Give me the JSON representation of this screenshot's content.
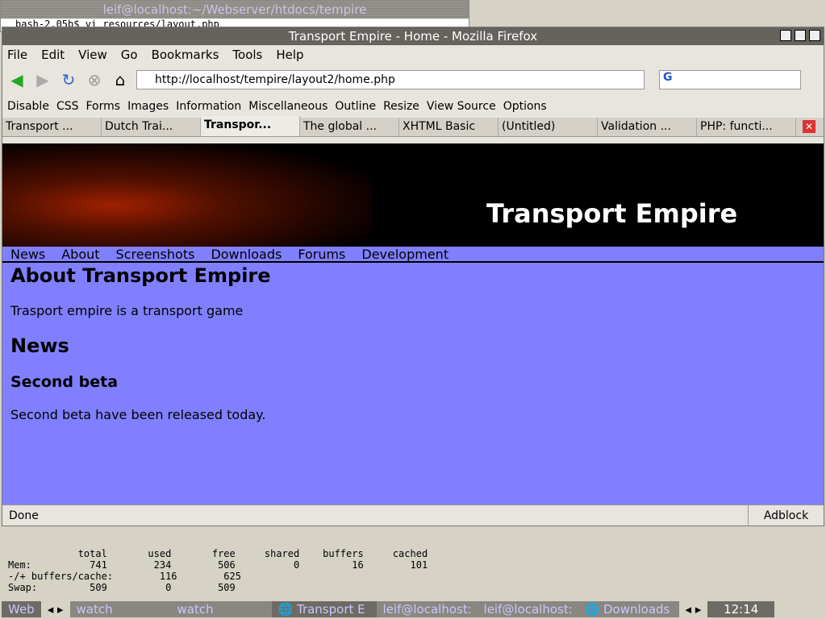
{
  "terminal": {
    "title": "leif@localhost:~/Webserver/htdocs/tempire",
    "command": "bash-2.05b$ vi resources/layout.php"
  },
  "firefox": {
    "title": "Transport Empire - Home - Mozilla Firefox",
    "menu": [
      "File",
      "Edit",
      "View",
      "Go",
      "Bookmarks",
      "Tools",
      "Help"
    ],
    "url": "http://localhost/tempire/layout2/home.php",
    "search_placeholder": "G",
    "devbar": [
      "Disable",
      "CSS",
      "Forms",
      "Images",
      "Information",
      "Miscellaneous",
      "Outline",
      "Resize",
      "View Source",
      "Options"
    ],
    "tabs": [
      "Transport ...",
      "Dutch Trai...",
      "Transpor...",
      "The global ...",
      "XHTML Basic",
      "(Untitled)",
      "Validation ...",
      "PHP: functi..."
    ],
    "status": "Done",
    "adblock": "Adblock"
  },
  "page": {
    "site_title": "Transport Empire",
    "nav": [
      "News",
      "About",
      "Screenshots",
      "Downloads",
      "Forums",
      "Development"
    ],
    "about_heading": "About Transport Empire",
    "about_text": "Trasport empire is a transport game",
    "news_heading": "News",
    "news_title": "Second beta",
    "news_text": "Second beta have been released today."
  },
  "free_output": "            total       used       free     shared    buffers     cached\nMem:          741        234        506          0         16        101\n-/+ buffers/cache:        116        625\nSwap:         509          0        509",
  "taskbar": {
    "items": [
      "Web",
      "watch",
      "watch",
      "Transport E",
      "leif@localhost:",
      "leif@localhost:",
      "Downloads"
    ],
    "clock": "12:14"
  }
}
